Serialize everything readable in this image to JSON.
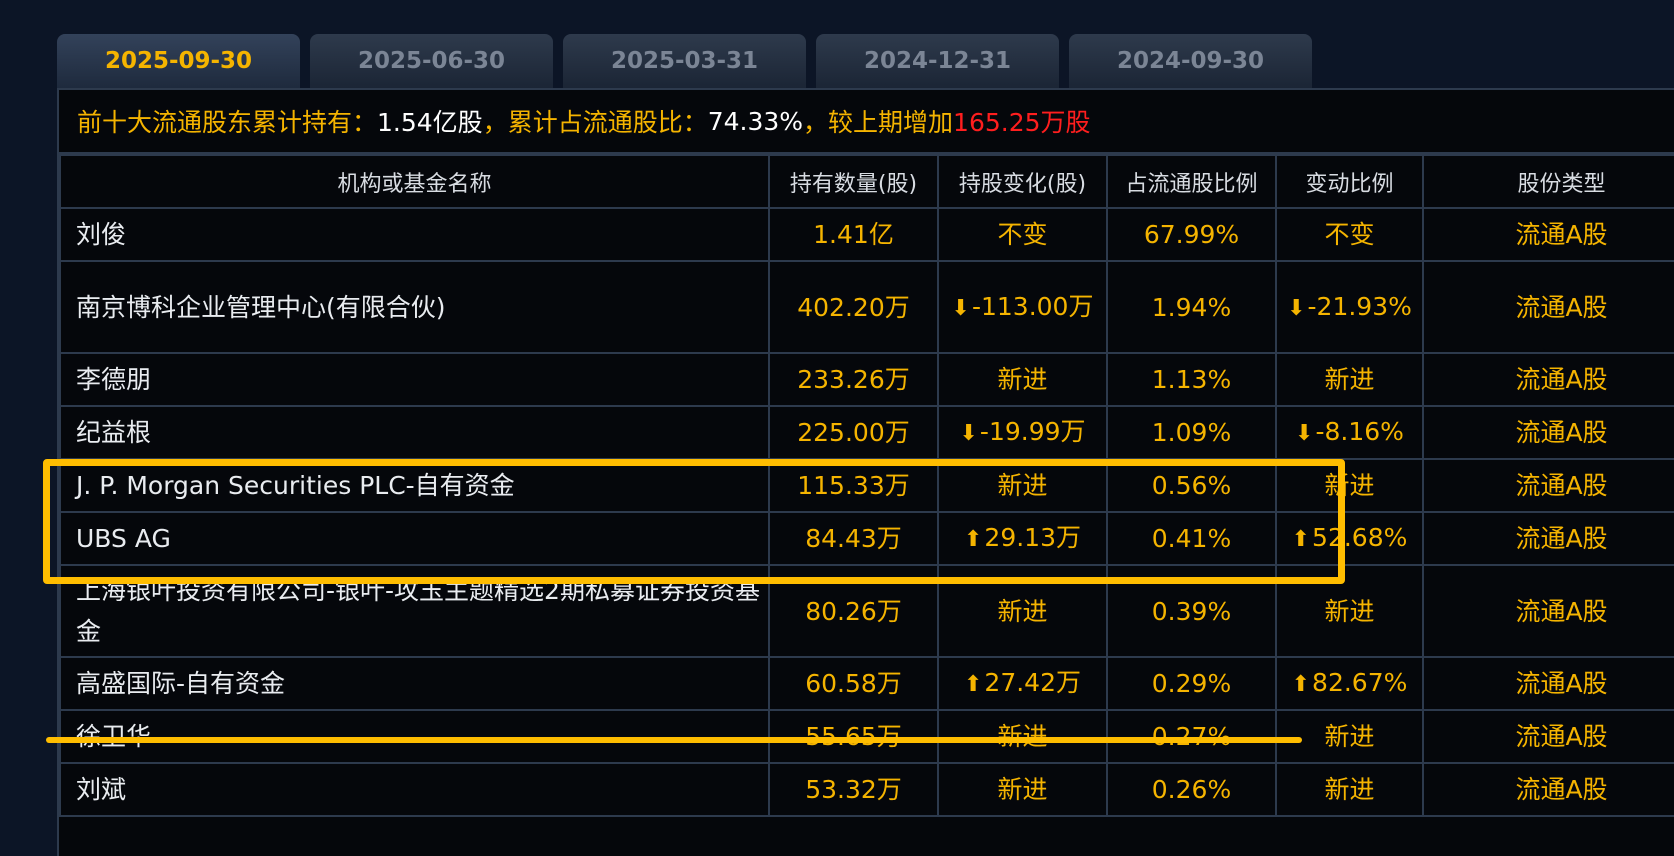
{
  "tabs": [
    {
      "label": "2025-09-30",
      "active": true
    },
    {
      "label": "2025-06-30",
      "active": false
    },
    {
      "label": "2025-03-31",
      "active": false
    },
    {
      "label": "2024-12-31",
      "active": false
    },
    {
      "label": "2024-09-30",
      "active": false
    }
  ],
  "summary": {
    "label_holding": "前十大流通股东累计持有：",
    "holding_value": "1.54亿股",
    "label_ratio": "，累计占流通股比：",
    "ratio_value": "74.33%",
    "label_change": " ，较上期增加",
    "change_value": "165.25万股"
  },
  "table": {
    "headers": [
      "机构或基金名称",
      "持有数量(股)",
      "持股变化(股)",
      "占流通股比例",
      "变动比例",
      "股份类型"
    ],
    "rows": [
      {
        "name": "刘俊",
        "quantity": "1.41亿",
        "change": "不变",
        "change_dir": "none",
        "ratio": "67.99%",
        "change_ratio": "不变",
        "change_ratio_dir": "none",
        "type": "流通A股"
      },
      {
        "name": "南京博科企业管理中心(有限合伙)",
        "quantity": "402.20万",
        "change": "-113.00万",
        "change_dir": "down",
        "ratio": "1.94%",
        "change_ratio": "-21.93%",
        "change_ratio_dir": "down",
        "type": "流通A股"
      },
      {
        "name": "李德朋",
        "quantity": "233.26万",
        "change": "新进",
        "change_dir": "new",
        "ratio": "1.13%",
        "change_ratio": "新进",
        "change_ratio_dir": "new",
        "type": "流通A股"
      },
      {
        "name": "纪益根",
        "quantity": "225.00万",
        "change": "-19.99万",
        "change_dir": "down",
        "ratio": "1.09%",
        "change_ratio": "-8.16%",
        "change_ratio_dir": "down",
        "type": "流通A股"
      },
      {
        "name": "J. P. Morgan Securities PLC-自有资金",
        "quantity": "115.33万",
        "change": "新进",
        "change_dir": "new",
        "ratio": "0.56%",
        "change_ratio": "新进",
        "change_ratio_dir": "new",
        "type": "流通A股"
      },
      {
        "name": "UBS AG",
        "quantity": "84.43万",
        "change": "29.13万",
        "change_dir": "up",
        "ratio": "0.41%",
        "change_ratio": "52.68%",
        "change_ratio_dir": "up",
        "type": "流通A股"
      },
      {
        "name": "上海银叶投资有限公司-银叶-攻玉主题精选2期私募证券投资基金",
        "quantity": "80.26万",
        "change": "新进",
        "change_dir": "new",
        "ratio": "0.39%",
        "change_ratio": "新进",
        "change_ratio_dir": "new",
        "type": "流通A股"
      },
      {
        "name": "高盛国际-自有资金",
        "quantity": "60.58万",
        "change": "27.42万",
        "change_dir": "up",
        "ratio": "0.29%",
        "change_ratio": "82.67%",
        "change_ratio_dir": "up",
        "type": "流通A股"
      },
      {
        "name": "徐卫华",
        "quantity": "55.65万",
        "change": "新进",
        "change_dir": "new",
        "ratio": "0.27%",
        "change_ratio": "新进",
        "change_ratio_dir": "new",
        "type": "流通A股"
      },
      {
        "name": "刘斌",
        "quantity": "53.32万",
        "change": "新进",
        "change_dir": "new",
        "ratio": "0.26%",
        "change_ratio": "新进",
        "change_ratio_dir": "new",
        "type": "流通A股"
      }
    ]
  },
  "colors": {
    "accent": "#f5b400",
    "increase": "#ff1e1e",
    "decrease": "#4cc21c",
    "annotation": "#ffbd00"
  },
  "icons": {
    "up": "arrow-up-icon",
    "down": "arrow-down-icon"
  }
}
